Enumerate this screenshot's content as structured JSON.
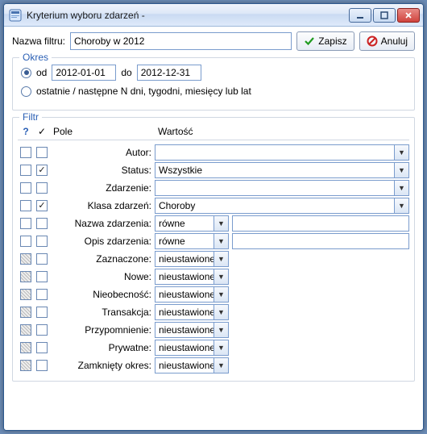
{
  "window": {
    "title": "Kryterium wyboru zdarzeń -"
  },
  "top": {
    "filter_name_label": "Nazwa filtru:",
    "filter_name_value": "Choroby w 2012",
    "save_label": "Zapisz",
    "cancel_label": "Anuluj"
  },
  "okres": {
    "legend": "Okres",
    "radio_od_label": "od",
    "date_from": "2012-01-01",
    "do_label": "do",
    "date_to": "2012-12-31",
    "radio_relative_label": "ostatnie / następne N dni, tygodni, miesięcy lub lat"
  },
  "filtr": {
    "legend": "Filtr",
    "header_q": "?",
    "header_chk": "✓",
    "header_field": "Pole",
    "header_value": "Wartość",
    "rows": [
      {
        "label": "Autor:",
        "type": "full",
        "value": "",
        "chk1": "empty",
        "chk2": "empty"
      },
      {
        "label": "Status:",
        "type": "full",
        "value": "Wszystkie",
        "chk1": "empty",
        "chk2": "checked"
      },
      {
        "label": "Zdarzenie:",
        "type": "full",
        "value": "",
        "chk1": "empty",
        "chk2": "empty"
      },
      {
        "label": "Klasa zdarzeń:",
        "type": "full",
        "value": "Choroby",
        "chk1": "empty",
        "chk2": "checked"
      },
      {
        "label": "Nazwa zdarzenia:",
        "type": "pair",
        "value": "równe",
        "chk1": "empty",
        "chk2": "empty"
      },
      {
        "label": "Opis zdarzenia:",
        "type": "pair",
        "value": "równe",
        "chk1": "empty",
        "chk2": "empty"
      },
      {
        "label": "Zaznaczone:",
        "type": "short",
        "value": "nieustawione",
        "chk1": "hatched",
        "chk2": "empty"
      },
      {
        "label": "Nowe:",
        "type": "short",
        "value": "nieustawione",
        "chk1": "hatched",
        "chk2": "empty"
      },
      {
        "label": "Nieobecność:",
        "type": "short",
        "value": "nieustawione",
        "chk1": "hatched",
        "chk2": "empty"
      },
      {
        "label": "Transakcja:",
        "type": "short",
        "value": "nieustawione",
        "chk1": "hatched",
        "chk2": "empty"
      },
      {
        "label": "Przypomnienie:",
        "type": "short",
        "value": "nieustawione",
        "chk1": "hatched",
        "chk2": "empty"
      },
      {
        "label": "Prywatne:",
        "type": "short",
        "value": "nieustawione",
        "chk1": "hatched",
        "chk2": "empty"
      },
      {
        "label": "Zamknięty okres:",
        "type": "short",
        "value": "nieustawione",
        "chk1": "hatched",
        "chk2": "empty"
      }
    ]
  }
}
